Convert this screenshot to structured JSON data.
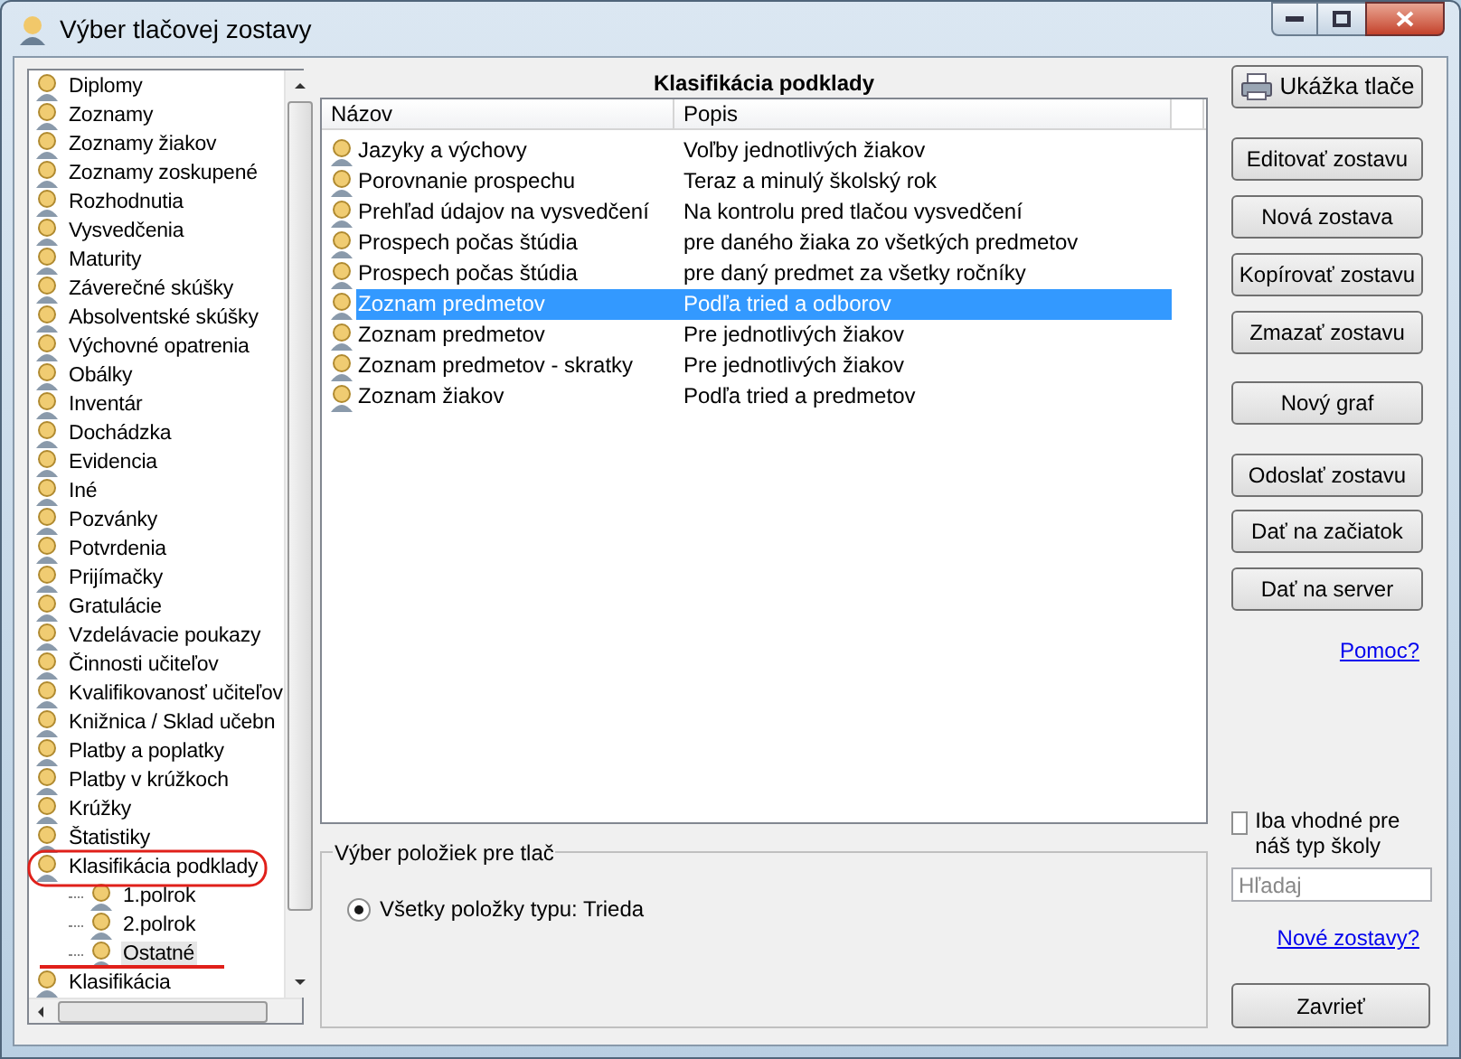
{
  "window": {
    "title": "Výber tlačovej zostavy"
  },
  "tree": [
    {
      "label": "Diplomy",
      "selected": false
    },
    {
      "label": "Zoznamy",
      "selected": false
    },
    {
      "label": "Zoznamy žiakov",
      "selected": false
    },
    {
      "label": "Zoznamy zoskupené",
      "selected": false
    },
    {
      "label": "Rozhodnutia",
      "selected": false
    },
    {
      "label": "Vysvedčenia",
      "selected": false
    },
    {
      "label": "Maturity",
      "selected": false
    },
    {
      "label": "Záverečné skúšky",
      "selected": false
    },
    {
      "label": "Absolventské skúšky",
      "selected": false
    },
    {
      "label": "Výchovné opatrenia",
      "selected": false
    },
    {
      "label": "Obálky",
      "selected": false
    },
    {
      "label": "Inventár",
      "selected": false
    },
    {
      "label": "Dochádzka",
      "selected": false
    },
    {
      "label": "Evidencia",
      "selected": false
    },
    {
      "label": "Iné",
      "selected": false
    },
    {
      "label": "Pozvánky",
      "selected": false
    },
    {
      "label": "Potvrdenia",
      "selected": false
    },
    {
      "label": "Prijímačky",
      "selected": false
    },
    {
      "label": "Gratulácie",
      "selected": false
    },
    {
      "label": "Vzdelávacie poukazy",
      "selected": false
    },
    {
      "label": "Činnosti učiteľov",
      "selected": false
    },
    {
      "label": "Kvalifikovanosť učiteľov",
      "selected": false
    },
    {
      "label": "Knižnica / Sklad učebn",
      "selected": false
    },
    {
      "label": "Platby a poplatky",
      "selected": false
    },
    {
      "label": "Platby v krúžkoch",
      "selected": false
    },
    {
      "label": "Krúžky",
      "selected": false
    },
    {
      "label": "Štatistiky",
      "selected": false
    },
    {
      "label": "Klasifikácia podklady",
      "selected": false,
      "expanded": true,
      "children": [
        {
          "label": "1.polrok",
          "selected": false
        },
        {
          "label": "2.polrok",
          "selected": false
        },
        {
          "label": "Ostatné",
          "selected": true
        }
      ]
    },
    {
      "label": "Klasifikácia",
      "selected": false
    }
  ],
  "list": {
    "title": "Klasifikácia podklady",
    "columns": [
      "Názov",
      "Popis"
    ],
    "rows": [
      {
        "name": "Jazyky a výchovy",
        "description": "Voľby jednotlivých žiakov",
        "selected": false
      },
      {
        "name": "Porovnanie prospechu",
        "description": "Teraz a minulý školský rok",
        "selected": false
      },
      {
        "name": "Prehľad údajov na vysvedčení",
        "description": "Na kontrolu pred tlačou vysvedčení",
        "selected": false
      },
      {
        "name": "Prospech počas štúdia",
        "description": "pre daného žiaka zo všetkých predmetov",
        "selected": false
      },
      {
        "name": "Prospech počas štúdia",
        "description": "pre daný predmet za všetky ročníky",
        "selected": false
      },
      {
        "name": "Zoznam predmetov",
        "description": "Podľa tried a odborov",
        "selected": true
      },
      {
        "name": "Zoznam predmetov",
        "description": "Pre jednotlivých žiakov",
        "selected": false
      },
      {
        "name": "Zoznam predmetov - skratky",
        "description": "Pre jednotlivých žiakov",
        "selected": false
      },
      {
        "name": "Zoznam žiakov",
        "description": "Podľa tried a predmetov",
        "selected": false
      }
    ]
  },
  "print_selection": {
    "legend": "Výber položiek pre tlač",
    "options": [
      {
        "label": "Všetky položky typu: Trieda",
        "selected": true
      }
    ]
  },
  "actions": [
    {
      "label": "Ukážka tlače",
      "kind": "print"
    },
    {
      "label": "Editovať zostavu",
      "kind": "button"
    },
    {
      "label": "Nová zostava",
      "kind": "button"
    },
    {
      "label": "Kopírovať zostavu",
      "kind": "button"
    },
    {
      "label": "Zmazať zostavu",
      "kind": "button"
    },
    {
      "label": "Nový graf",
      "kind": "button"
    },
    {
      "label": "Odoslať zostavu",
      "kind": "button"
    },
    {
      "label": "Dať na začiatok",
      "kind": "button"
    },
    {
      "label": "Dať na server",
      "kind": "button"
    }
  ],
  "help_link": "Pomoc?",
  "filter": {
    "label": "Iba vhodné pre náš typ školy",
    "checked": false
  },
  "search": {
    "placeholder": "Hľadaj"
  },
  "new_reports_link": "Nové zostavy?",
  "close_button": "Zavrieť"
}
